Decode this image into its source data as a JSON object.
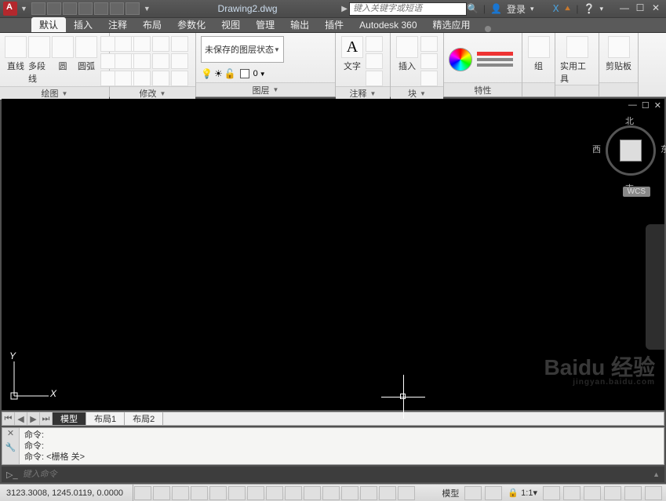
{
  "title": "Drawing2.dwg",
  "search_placeholder": "键入关键字或短语",
  "login": "登录",
  "tabs": [
    "默认",
    "插入",
    "注释",
    "布局",
    "参数化",
    "视图",
    "管理",
    "输出",
    "插件",
    "Autodesk 360",
    "精选应用"
  ],
  "active_tab": 0,
  "ribbon": {
    "draw": {
      "title": "绘图",
      "tools": [
        "直线",
        "多段线",
        "圆",
        "圆弧"
      ]
    },
    "modify": {
      "title": "修改"
    },
    "layer": {
      "title": "图层",
      "combo": "未保存的图层状态",
      "current": "0"
    },
    "annotate": {
      "title": "注释",
      "tool": "文字"
    },
    "block": {
      "title": "块",
      "tool": "插入"
    },
    "props": {
      "title": "特性"
    },
    "group": {
      "title": "组"
    },
    "util": {
      "title": "实用工具"
    },
    "clip": {
      "title": "剪贴板"
    }
  },
  "viewcube": {
    "n": "北",
    "s": "南",
    "e": "东",
    "w": "西",
    "wcs": "WCS"
  },
  "layout_tabs": [
    "模型",
    "布局1",
    "布局2"
  ],
  "active_layout": 0,
  "cmd_history": [
    "命令:",
    "命令:",
    "命令:  <栅格 关>"
  ],
  "cmd_placeholder": "键入命令",
  "coords": "3123.3008, 1245.0119, 0.0000",
  "status_right": {
    "model": "模型",
    "scale": "1:1"
  },
  "ucs": {
    "x": "X",
    "y": "Y"
  },
  "watermark": {
    "main": "Baidu 经验",
    "sub": "jingyan.baidu.com"
  }
}
